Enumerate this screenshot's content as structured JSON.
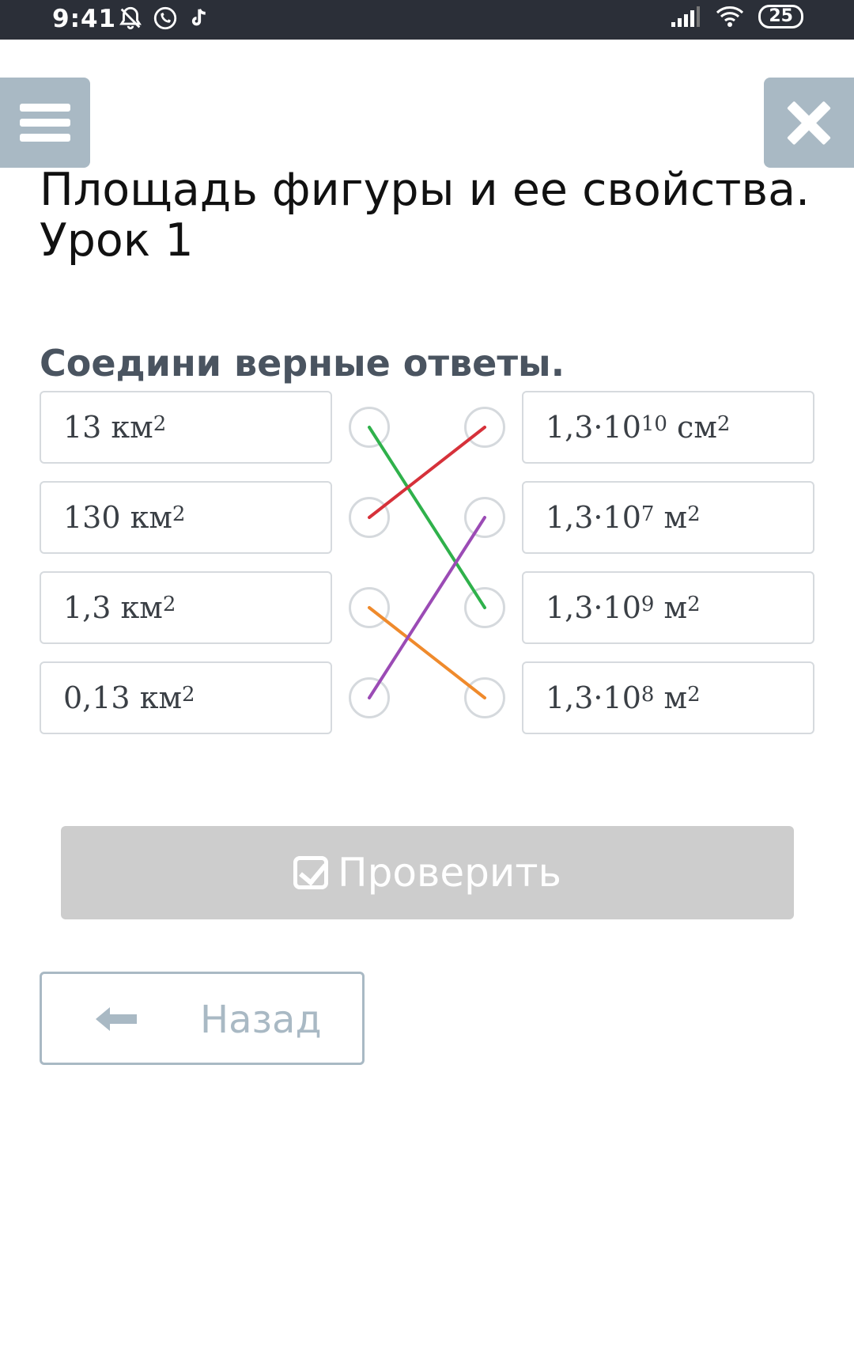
{
  "status_bar": {
    "time": "9:41",
    "battery": "25"
  },
  "page": {
    "title_line1": "Площадь фигуры и ее свойства.",
    "title_line2": "Урок 1",
    "instruction": "Соедини верные ответы."
  },
  "left_items": [
    {
      "num": "13 км",
      "exp": "2"
    },
    {
      "num": "130 км",
      "exp": "2"
    },
    {
      "num": "1,3 км",
      "exp": "2"
    },
    {
      "num": "0,13 км",
      "exp": "2"
    }
  ],
  "right_items": [
    {
      "base": "1,3·10",
      "exp": "10",
      "unit": " см",
      "unit_exp": "2"
    },
    {
      "base": "1,3·10",
      "exp": "7",
      "unit": " м",
      "unit_exp": "2"
    },
    {
      "base": "1,3·10",
      "exp": "9",
      "unit": " м",
      "unit_exp": "2"
    },
    {
      "base": "1,3·10",
      "exp": "8",
      "unit": " м",
      "unit_exp": "2"
    }
  ],
  "connections": [
    {
      "from": 0,
      "to": 2,
      "color": "#2fb14b"
    },
    {
      "from": 1,
      "to": 0,
      "color": "#d6313a"
    },
    {
      "from": 2,
      "to": 3,
      "color": "#ef8a2c"
    },
    {
      "from": 3,
      "to": 1,
      "color": "#9b4bb5"
    }
  ],
  "buttons": {
    "check_label": "Проверить",
    "back_label": "Назад"
  },
  "colors": {
    "accent": "#a9b9c4",
    "disabled_button": "#cdcdcd",
    "status_bar": "#2b2f38"
  },
  "icons": [
    "notification-off-icon",
    "whatsapp-icon",
    "tiktok-icon",
    "signal-icon",
    "wifi-icon",
    "battery-icon",
    "menu-icon",
    "close-icon",
    "checkbox-icon",
    "arrow-left-icon"
  ]
}
